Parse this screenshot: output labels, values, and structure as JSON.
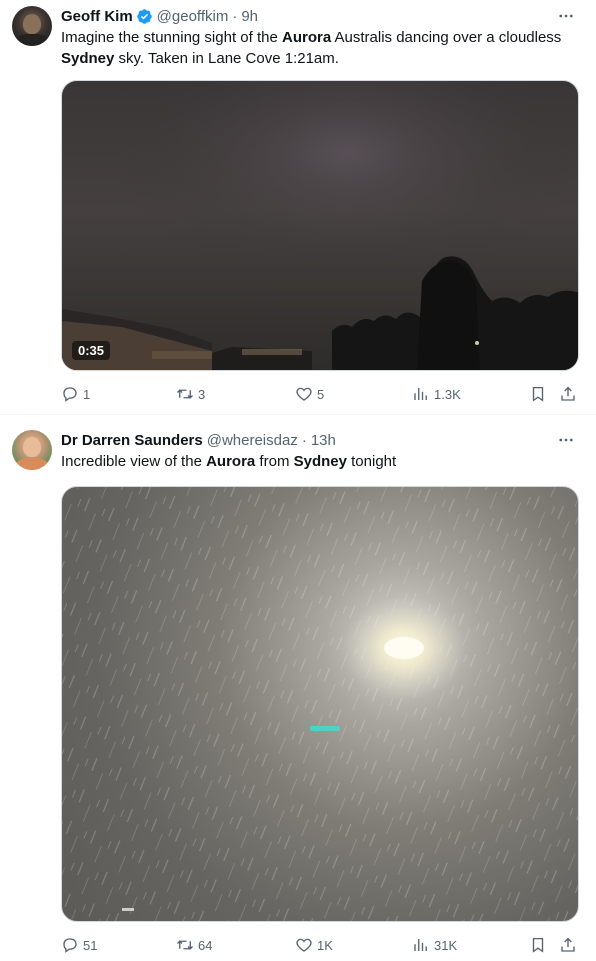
{
  "tweets": [
    {
      "author": {
        "name": "Geoff Kim",
        "handle": "@geoffkim",
        "time": "9h",
        "verified": true
      },
      "text": {
        "p1": "Imagine the stunning sight of the ",
        "b1": "Aurora",
        "p2": " Australis dancing over a cloudless ",
        "b2": "Sydney",
        "p3": " sky. Taken in Lane Cove 1:21am."
      },
      "media": {
        "type": "video",
        "duration": "0:35"
      },
      "stats": {
        "replies": "1",
        "retweets": "3",
        "likes": "5",
        "views": "1.3K"
      }
    },
    {
      "author": {
        "name": "Dr Darren Saunders",
        "handle": "@whereisdaz",
        "time": "13h",
        "verified": false
      },
      "text": {
        "p1": "Incredible view of the ",
        "b1": "Aurora",
        "p2": " from ",
        "b2": "Sydney",
        "p3": " tonight"
      },
      "media": {
        "type": "photo"
      },
      "stats": {
        "replies": "51",
        "retweets": "64",
        "likes": "1K",
        "views": "31K"
      }
    }
  ],
  "colors": {
    "verified": "#1d9bf0",
    "secondary_text": "#536471",
    "divider": "#eff3f4"
  },
  "icons": [
    "more-icon",
    "verified-badge-icon",
    "reply-icon",
    "retweet-icon",
    "like-icon",
    "views-icon",
    "bookmark-icon",
    "share-icon"
  ]
}
